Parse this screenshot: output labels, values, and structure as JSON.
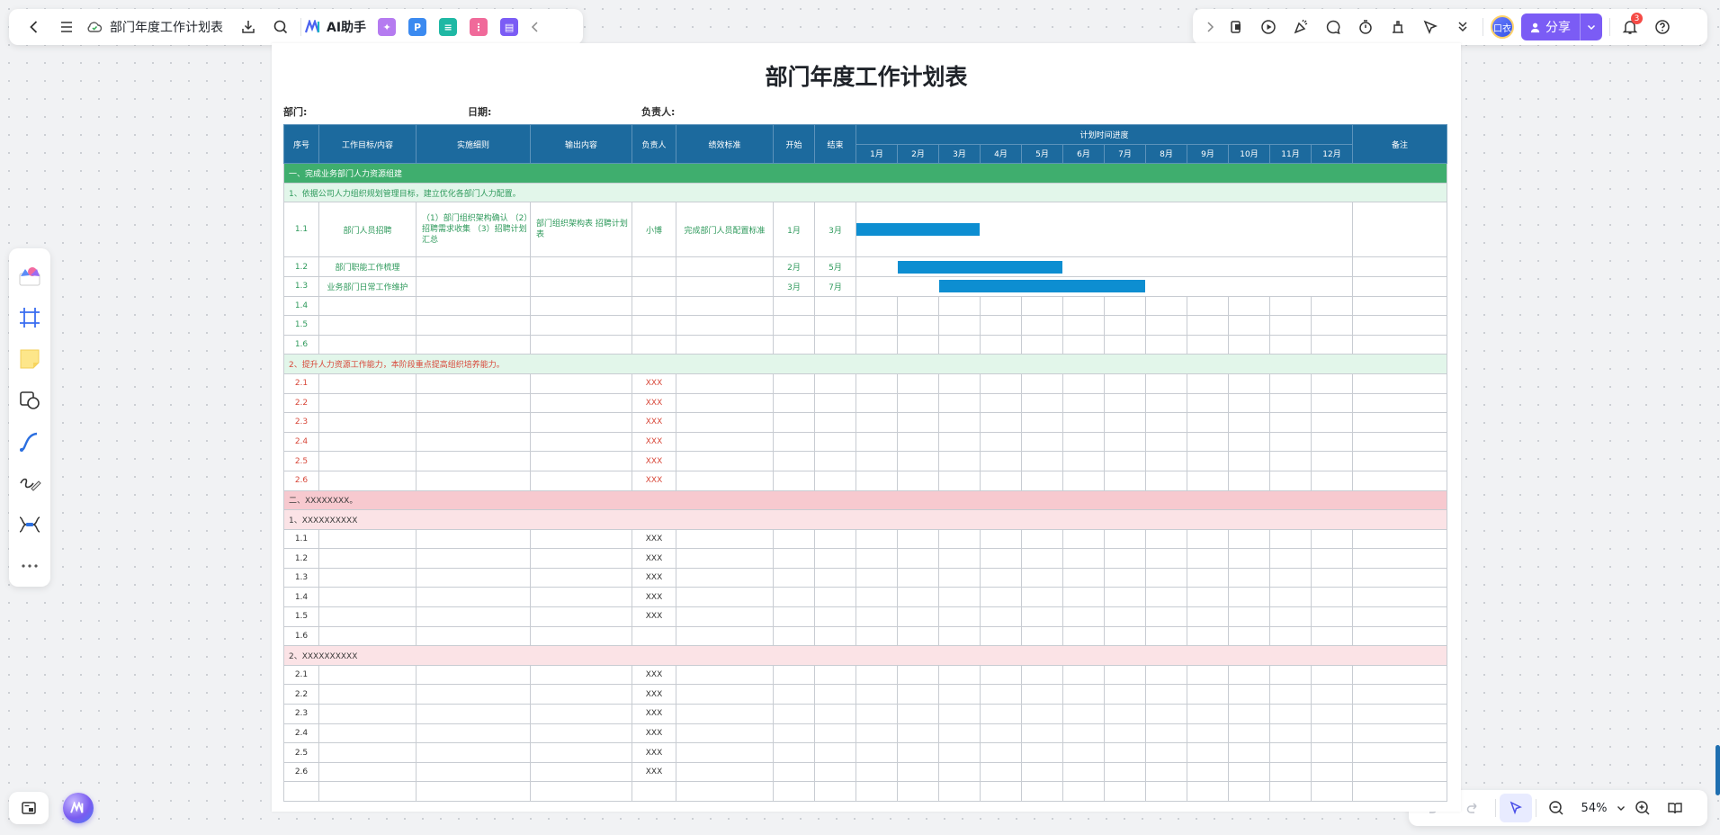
{
  "topbar": {
    "doc_title": "部门年度工作计划表",
    "ai_label": "AI助手",
    "apps": [
      {
        "name": "image-gen",
        "color": "#b57bf0",
        "glyph": "✦"
      },
      {
        "name": "p-app",
        "color": "#3b8af0",
        "glyph": "P"
      },
      {
        "name": "mindmap",
        "color": "#1fb8a4",
        "glyph": "≡"
      },
      {
        "name": "flow",
        "color": "#f06a9a",
        "glyph": "⋮"
      },
      {
        "name": "chat",
        "color": "#7b5cf5",
        "glyph": "▤"
      }
    ]
  },
  "topright": {
    "avatar_text": "口衣",
    "share_label": "分享",
    "notif_count": "3"
  },
  "bottom": {
    "zoom": "54%"
  },
  "sheet": {
    "title": "部门年度工作计划表",
    "meta": {
      "dept": "部门:",
      "date": "日期:",
      "owner": "负责人:"
    },
    "headers": {
      "seq": "序号",
      "goal": "工作目标/内容",
      "detail": "实施细则",
      "output": "输出内容",
      "owner": "负责人",
      "kpi": "绩效标准",
      "start": "开始",
      "end": "结束",
      "progress": "计划时间进度",
      "remark": "备注",
      "months": [
        "1月",
        "2月",
        "3月",
        "4月",
        "5月",
        "6月",
        "7月",
        "8月",
        "9月",
        "10月",
        "11月",
        "12月"
      ]
    },
    "part1": {
      "title": "一、完成业务部门人力资源组建",
      "sub1": {
        "title": "1、依据公司人力组织规划管理目标，建立优化各部门人力配置。",
        "rows": [
          {
            "seq": "1.1",
            "goal": "部门人员招聘",
            "detail": "（1）部门组织架构确认\n（2）招聘需求收集\n（3）招聘计划汇总",
            "output": "部门组织架构表\n招聘计划表",
            "owner": "小博",
            "kpi": "完成部门人员配置标准",
            "start": "1月",
            "end": "3月",
            "bar_start": 1,
            "bar_end": 3
          },
          {
            "seq": "1.2",
            "goal": "部门职能工作梳理",
            "detail": "",
            "output": "",
            "owner": "",
            "kpi": "",
            "start": "2月",
            "end": "5月",
            "bar_start": 2,
            "bar_end": 5
          },
          {
            "seq": "1.3",
            "goal": "业务部门日常工作维护",
            "detail": "",
            "output": "",
            "owner": "",
            "kpi": "",
            "start": "3月",
            "end": "7月",
            "bar_start": 3,
            "bar_end": 7
          },
          {
            "seq": "1.4",
            "goal": "",
            "detail": "",
            "output": "",
            "owner": "",
            "kpi": "",
            "start": "",
            "end": ""
          },
          {
            "seq": "1.5",
            "goal": "",
            "detail": "",
            "output": "",
            "owner": "",
            "kpi": "",
            "start": "",
            "end": ""
          },
          {
            "seq": "1.6",
            "goal": "",
            "detail": "",
            "output": "",
            "owner": "",
            "kpi": "",
            "start": "",
            "end": ""
          }
        ]
      },
      "sub2": {
        "title": "2、提升人力资源工作能力，本阶段重点提高组织培养能力。",
        "rows": [
          {
            "seq": "2.1",
            "owner": "XXX"
          },
          {
            "seq": "2.2",
            "owner": "XXX"
          },
          {
            "seq": "2.3",
            "owner": "XXX"
          },
          {
            "seq": "2.4",
            "owner": "XXX"
          },
          {
            "seq": "2.5",
            "owner": "XXX"
          },
          {
            "seq": "2.6",
            "owner": "XXX"
          }
        ]
      }
    },
    "part2": {
      "title": "二、XXXXXXXX。",
      "sub1": {
        "title": "1、XXXXXXXXXX",
        "rows": [
          {
            "seq": "1.1",
            "owner": "XXX"
          },
          {
            "seq": "1.2",
            "owner": "XXX"
          },
          {
            "seq": "1.3",
            "owner": "XXX"
          },
          {
            "seq": "1.4",
            "owner": "XXX"
          },
          {
            "seq": "1.5",
            "owner": "XXX"
          },
          {
            "seq": "1.6",
            "owner": ""
          }
        ]
      },
      "sub2": {
        "title": "2、XXXXXXXXXX",
        "rows": [
          {
            "seq": "2.1",
            "owner": "XXX"
          },
          {
            "seq": "2.2",
            "owner": "XXX"
          },
          {
            "seq": "2.3",
            "owner": "XXX"
          },
          {
            "seq": "2.4",
            "owner": "XXX"
          },
          {
            "seq": "2.5",
            "owner": "XXX"
          },
          {
            "seq": "2.6",
            "owner": "XXX"
          },
          {
            "seq": "",
            "owner": ""
          }
        ]
      }
    }
  }
}
